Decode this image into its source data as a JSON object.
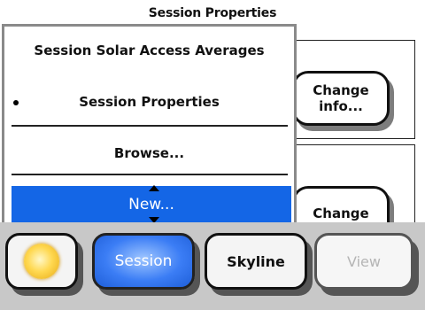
{
  "header": {
    "title": "Session Properties"
  },
  "panel": {
    "change_info_label": "Change\ninfo...",
    "change_label": "Change"
  },
  "menu": {
    "items": [
      {
        "label": "Session Solar Access Averages"
      },
      {
        "label": "Session Properties",
        "current": true
      },
      {
        "label": "Browse..."
      },
      {
        "label": "New...",
        "selected": true
      }
    ]
  },
  "toolbar": {
    "sun_icon": "sun-icon",
    "session_label": "Session",
    "skyline_label": "Skyline",
    "view_label": "View"
  },
  "colors": {
    "selection": "#1466e6",
    "session_button": "#3b7df5",
    "bottom_bar": "#c8c8c8",
    "disabled_text": "#b5b5b5"
  }
}
